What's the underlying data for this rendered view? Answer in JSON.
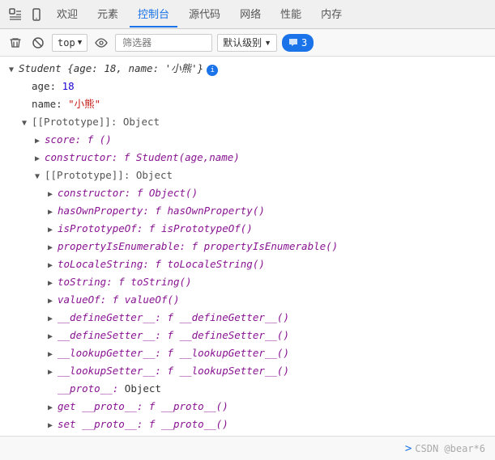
{
  "nav": {
    "tabs": [
      {
        "label": "欢迎",
        "active": false
      },
      {
        "label": "元素",
        "active": false
      },
      {
        "label": "控制台",
        "active": true
      },
      {
        "label": "源代码",
        "active": false
      },
      {
        "label": "网络",
        "active": false
      },
      {
        "label": "性能",
        "active": false
      },
      {
        "label": "内存",
        "active": false
      }
    ]
  },
  "toolbar": {
    "context_label": "top",
    "filter_placeholder": "筛选器",
    "level_label": "默认级别",
    "message_count": "3"
  },
  "console": {
    "root_label": "Student {age: 18, name: '小熊'}",
    "age_key": "age:",
    "age_val": "18",
    "name_key": "name:",
    "name_val": "\"小熊\"",
    "proto1_label": "[[Prototype]]: Object",
    "score_label": "score: f ()",
    "constructor1_label": "constructor: f Student(age,name)",
    "proto2_label": "[[Prototype]]: Object",
    "items": [
      {
        "indent": 4,
        "toggle": "closed",
        "text": "constructor: ",
        "func": "f Object()"
      },
      {
        "indent": 4,
        "toggle": "closed",
        "text": "hasOwnProperty: ",
        "func": "f hasOwnProperty()"
      },
      {
        "indent": 4,
        "toggle": "closed",
        "text": "isPrototypeOf: ",
        "func": "f isPrototypeOf()"
      },
      {
        "indent": 4,
        "toggle": "closed",
        "text": "propertyIsEnumerable: ",
        "func": "f propertyIsEnumerable()"
      },
      {
        "indent": 4,
        "toggle": "closed",
        "text": "toLocaleString: ",
        "func": "f toLocaleString()"
      },
      {
        "indent": 4,
        "toggle": "closed",
        "text": "toString: ",
        "func": "f toString()"
      },
      {
        "indent": 4,
        "toggle": "closed",
        "text": "valueOf: ",
        "func": "f valueOf()"
      },
      {
        "indent": 4,
        "toggle": "closed",
        "text": "__defineGetter__: ",
        "func": "f __defineGetter__()"
      },
      {
        "indent": 4,
        "toggle": "closed",
        "text": "__defineSetter__: ",
        "func": "f __defineSetter__()"
      },
      {
        "indent": 4,
        "toggle": "closed",
        "text": "__lookupGetter__: ",
        "func": "f __lookupGetter__()"
      },
      {
        "indent": 4,
        "toggle": "closed",
        "text": "__lookupSetter__: ",
        "func": "f __lookupSetter__()"
      },
      {
        "indent": 4,
        "toggle": "empty",
        "text": "__proto__: ",
        "func": "Object"
      },
      {
        "indent": 4,
        "toggle": "closed",
        "text": "get __proto__: ",
        "func": "f __proto__()"
      },
      {
        "indent": 4,
        "toggle": "closed",
        "text": "set __proto__: ",
        "func": "f __proto__()"
      }
    ]
  },
  "bottom": {
    "watermark": "CSDN @bear*6",
    "prompt": ">"
  }
}
